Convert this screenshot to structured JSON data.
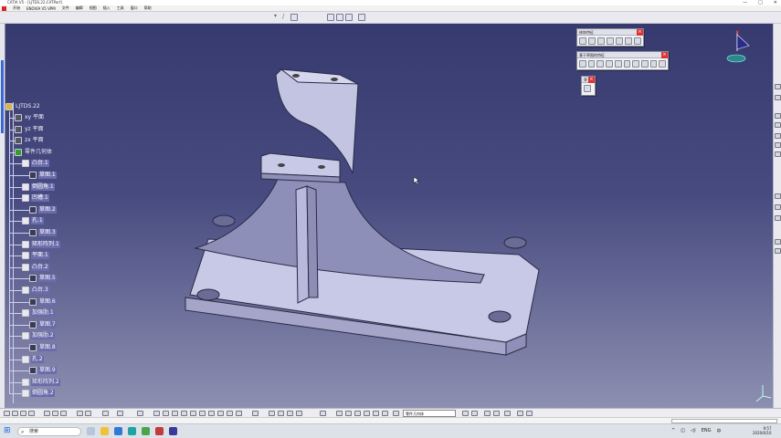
{
  "window": {
    "title": "CATIA V5 - [LJTDS.22.CATPart]",
    "controls": [
      "—",
      "□",
      "✕"
    ]
  },
  "menu": {
    "items": [
      "开始",
      "ENOVIA V5 VPM",
      "文件",
      "编辑",
      "视图",
      "插入",
      "工具",
      "窗口",
      "帮助"
    ]
  },
  "tree": {
    "root": "LJTDS.22",
    "nodes": [
      {
        "label": "xy 平面",
        "depth": 1
      },
      {
        "label": "yz 平面",
        "depth": 1
      },
      {
        "label": "zx 平面",
        "depth": 1
      },
      {
        "label": "零件几何体",
        "depth": 1
      },
      {
        "label": "凸台.1",
        "depth": 2
      },
      {
        "label": "草图.1",
        "depth": 3
      },
      {
        "label": "倒圆角.1",
        "depth": 2
      },
      {
        "label": "凹槽.1",
        "depth": 2
      },
      {
        "label": "草图.2",
        "depth": 3
      },
      {
        "label": "孔.1",
        "depth": 2
      },
      {
        "label": "草图.3",
        "depth": 3
      },
      {
        "label": "矩形阵列.1",
        "depth": 2
      },
      {
        "label": "平面.1",
        "depth": 2
      },
      {
        "label": "凸台.2",
        "depth": 2
      },
      {
        "label": "草图.5",
        "depth": 3
      },
      {
        "label": "凸台.3",
        "depth": 2
      },
      {
        "label": "草图.6",
        "depth": 3
      },
      {
        "label": "加强肋.1",
        "depth": 2
      },
      {
        "label": "草图.7",
        "depth": 3
      },
      {
        "label": "加强肋.2",
        "depth": 2
      },
      {
        "label": "草图.8",
        "depth": 3
      },
      {
        "label": "孔.2",
        "depth": 2
      },
      {
        "label": "草图.9",
        "depth": 3
      },
      {
        "label": "矩形阵列.2",
        "depth": 2
      },
      {
        "label": "倒圆角.2",
        "depth": 2
      }
    ]
  },
  "panels": {
    "p1": {
      "title": "修饰特征"
    },
    "p2": {
      "title": "基于草图的特征"
    },
    "p3": {
      "title": "草"
    }
  },
  "bottom": {
    "select_value": "零件几何体"
  },
  "taskbar": {
    "search_placeholder": "搜索",
    "time": "9:57",
    "date": "2020/6/16",
    "lang": "ENG",
    "ime": "中"
  },
  "colors": {
    "viewport_top": "#363a6e",
    "viewport_bottom": "#8d8fb1",
    "part": "#c8c9e6",
    "tree_text": "#f4f4ff"
  }
}
